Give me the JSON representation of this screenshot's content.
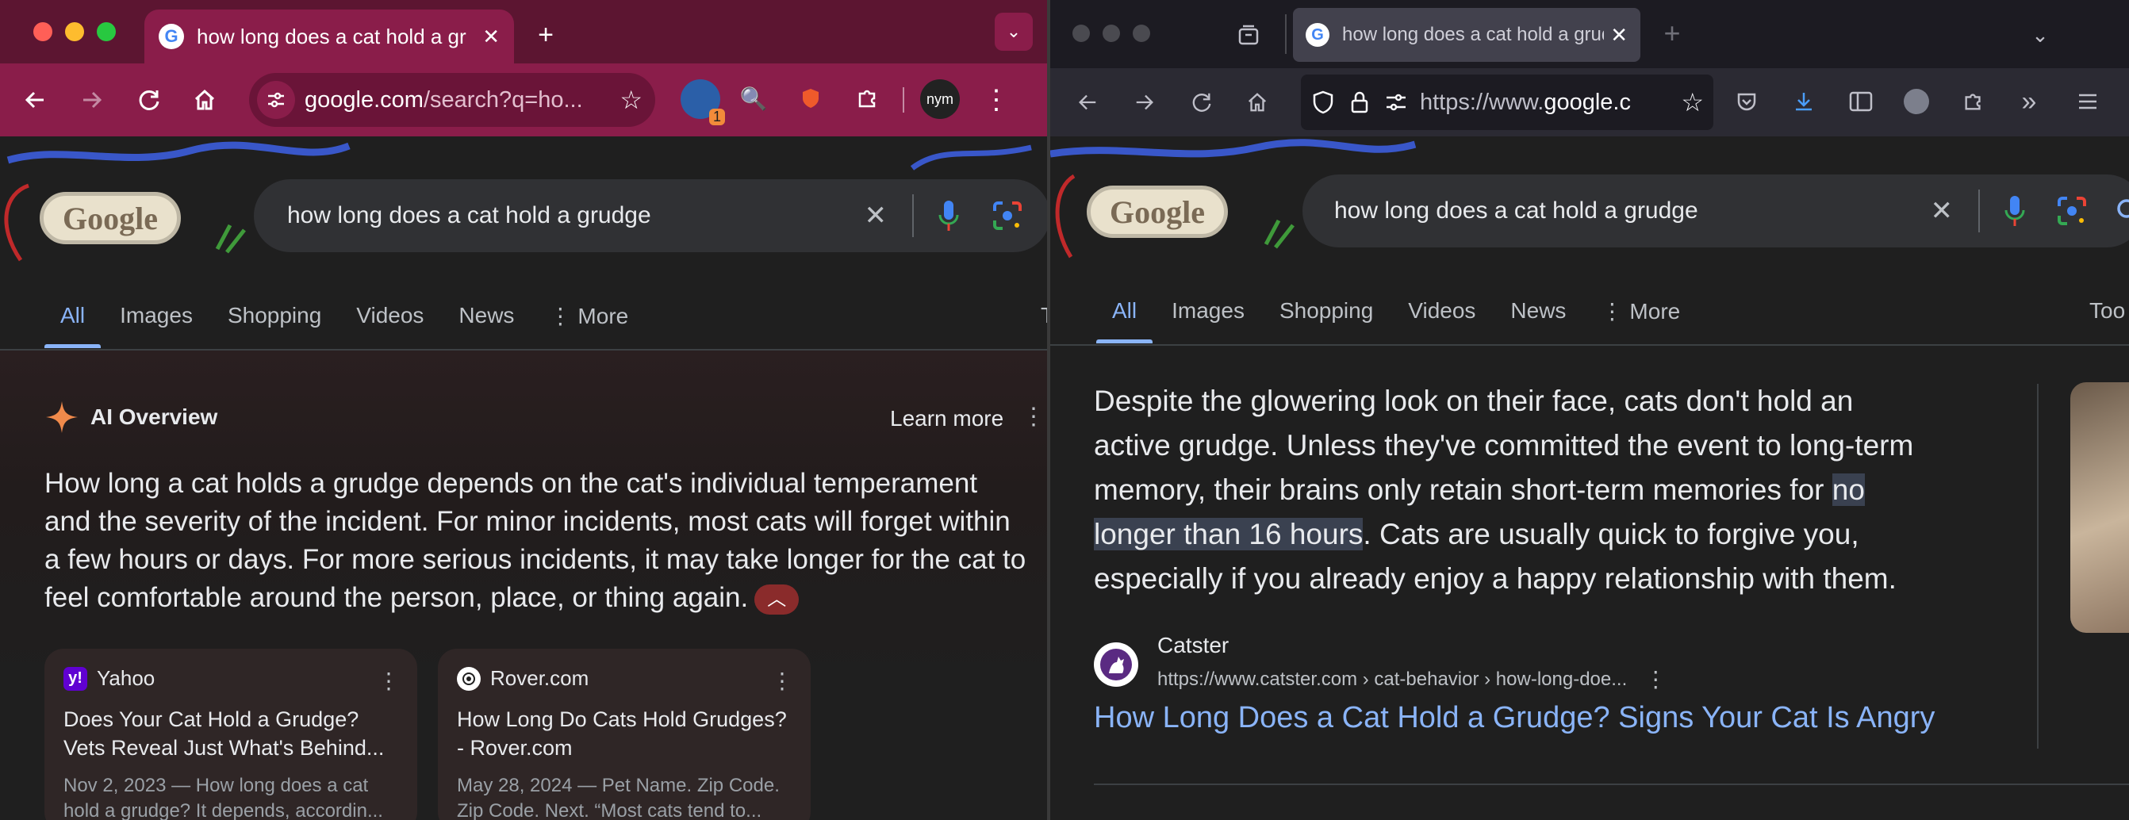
{
  "left": {
    "tab": {
      "title": "how long does a cat hold a gr",
      "close": "✕",
      "new": "+"
    },
    "omnibox": {
      "domain": "google.com",
      "path": "/search?q=ho..."
    },
    "extensions": {
      "badge": "1",
      "profile": "nym"
    },
    "search": {
      "query": "how long does a cat hold a grudge",
      "clear": "✕",
      "doodle": "Google"
    },
    "nav": {
      "items": [
        "All",
        "Images",
        "Shopping",
        "Videos",
        "News",
        "More"
      ],
      "active": "All",
      "edge": "T"
    },
    "ai_overview": {
      "title": "AI Overview",
      "learn_more": "Learn more",
      "text": "How long a cat holds a grudge depends on the cat's individual temperament and the severity of the incident. For minor incidents, most cats will forget within a few hours or days. For more serious incidents, it may take longer for the cat to feel comfortable around the person, place, or thing again."
    },
    "cards": [
      {
        "source": "Yahoo",
        "title": "Does Your Cat Hold a Grudge? Vets Reveal Just What's Behind...",
        "snippet": "Nov 2, 2023 — How long does a cat hold a grudge? It depends, accordin..."
      },
      {
        "source": "Rover.com",
        "title": "How Long Do Cats Hold Grudges? - Rover.com",
        "snippet": "May 28, 2024 — Pet Name. Zip Code. Zip Code. Next. “Most cats tend to..."
      }
    ]
  },
  "right": {
    "tab": {
      "title": "how long does a cat hold a grud",
      "close": "✕",
      "new": "+"
    },
    "url": {
      "prefix": "https://www.",
      "domain": "google.c"
    },
    "search": {
      "query": "how long does a cat hold a grudge",
      "clear": "✕",
      "doodle": "Google"
    },
    "nav": {
      "items": [
        "All",
        "Images",
        "Shopping",
        "Videos",
        "News",
        "More"
      ],
      "active": "All",
      "edge": "Too"
    },
    "snippet": {
      "before": "Despite the glowering look on their face, cats don't hold an active grudge. Unless they've committed the event to long-term memory, their brains only retain short-term memories for ",
      "highlight": "no longer than 16 hours",
      "after": ". Cats are usually quick to forgive you, especially if you already enjoy a happy relationship with them."
    },
    "result": {
      "site": "Catster",
      "breadcrumb": "https://www.catster.com › cat-behavior › how-long-doe...",
      "title": "How Long Does a Cat Hold a Grudge? Signs Your Cat Is Angry"
    }
  },
  "colors": {
    "chrome_frame": "#5c1531",
    "chrome_tab": "#8a1d4a",
    "link": "#8ab4f8",
    "ai_sparkle": "#f08a4b"
  }
}
